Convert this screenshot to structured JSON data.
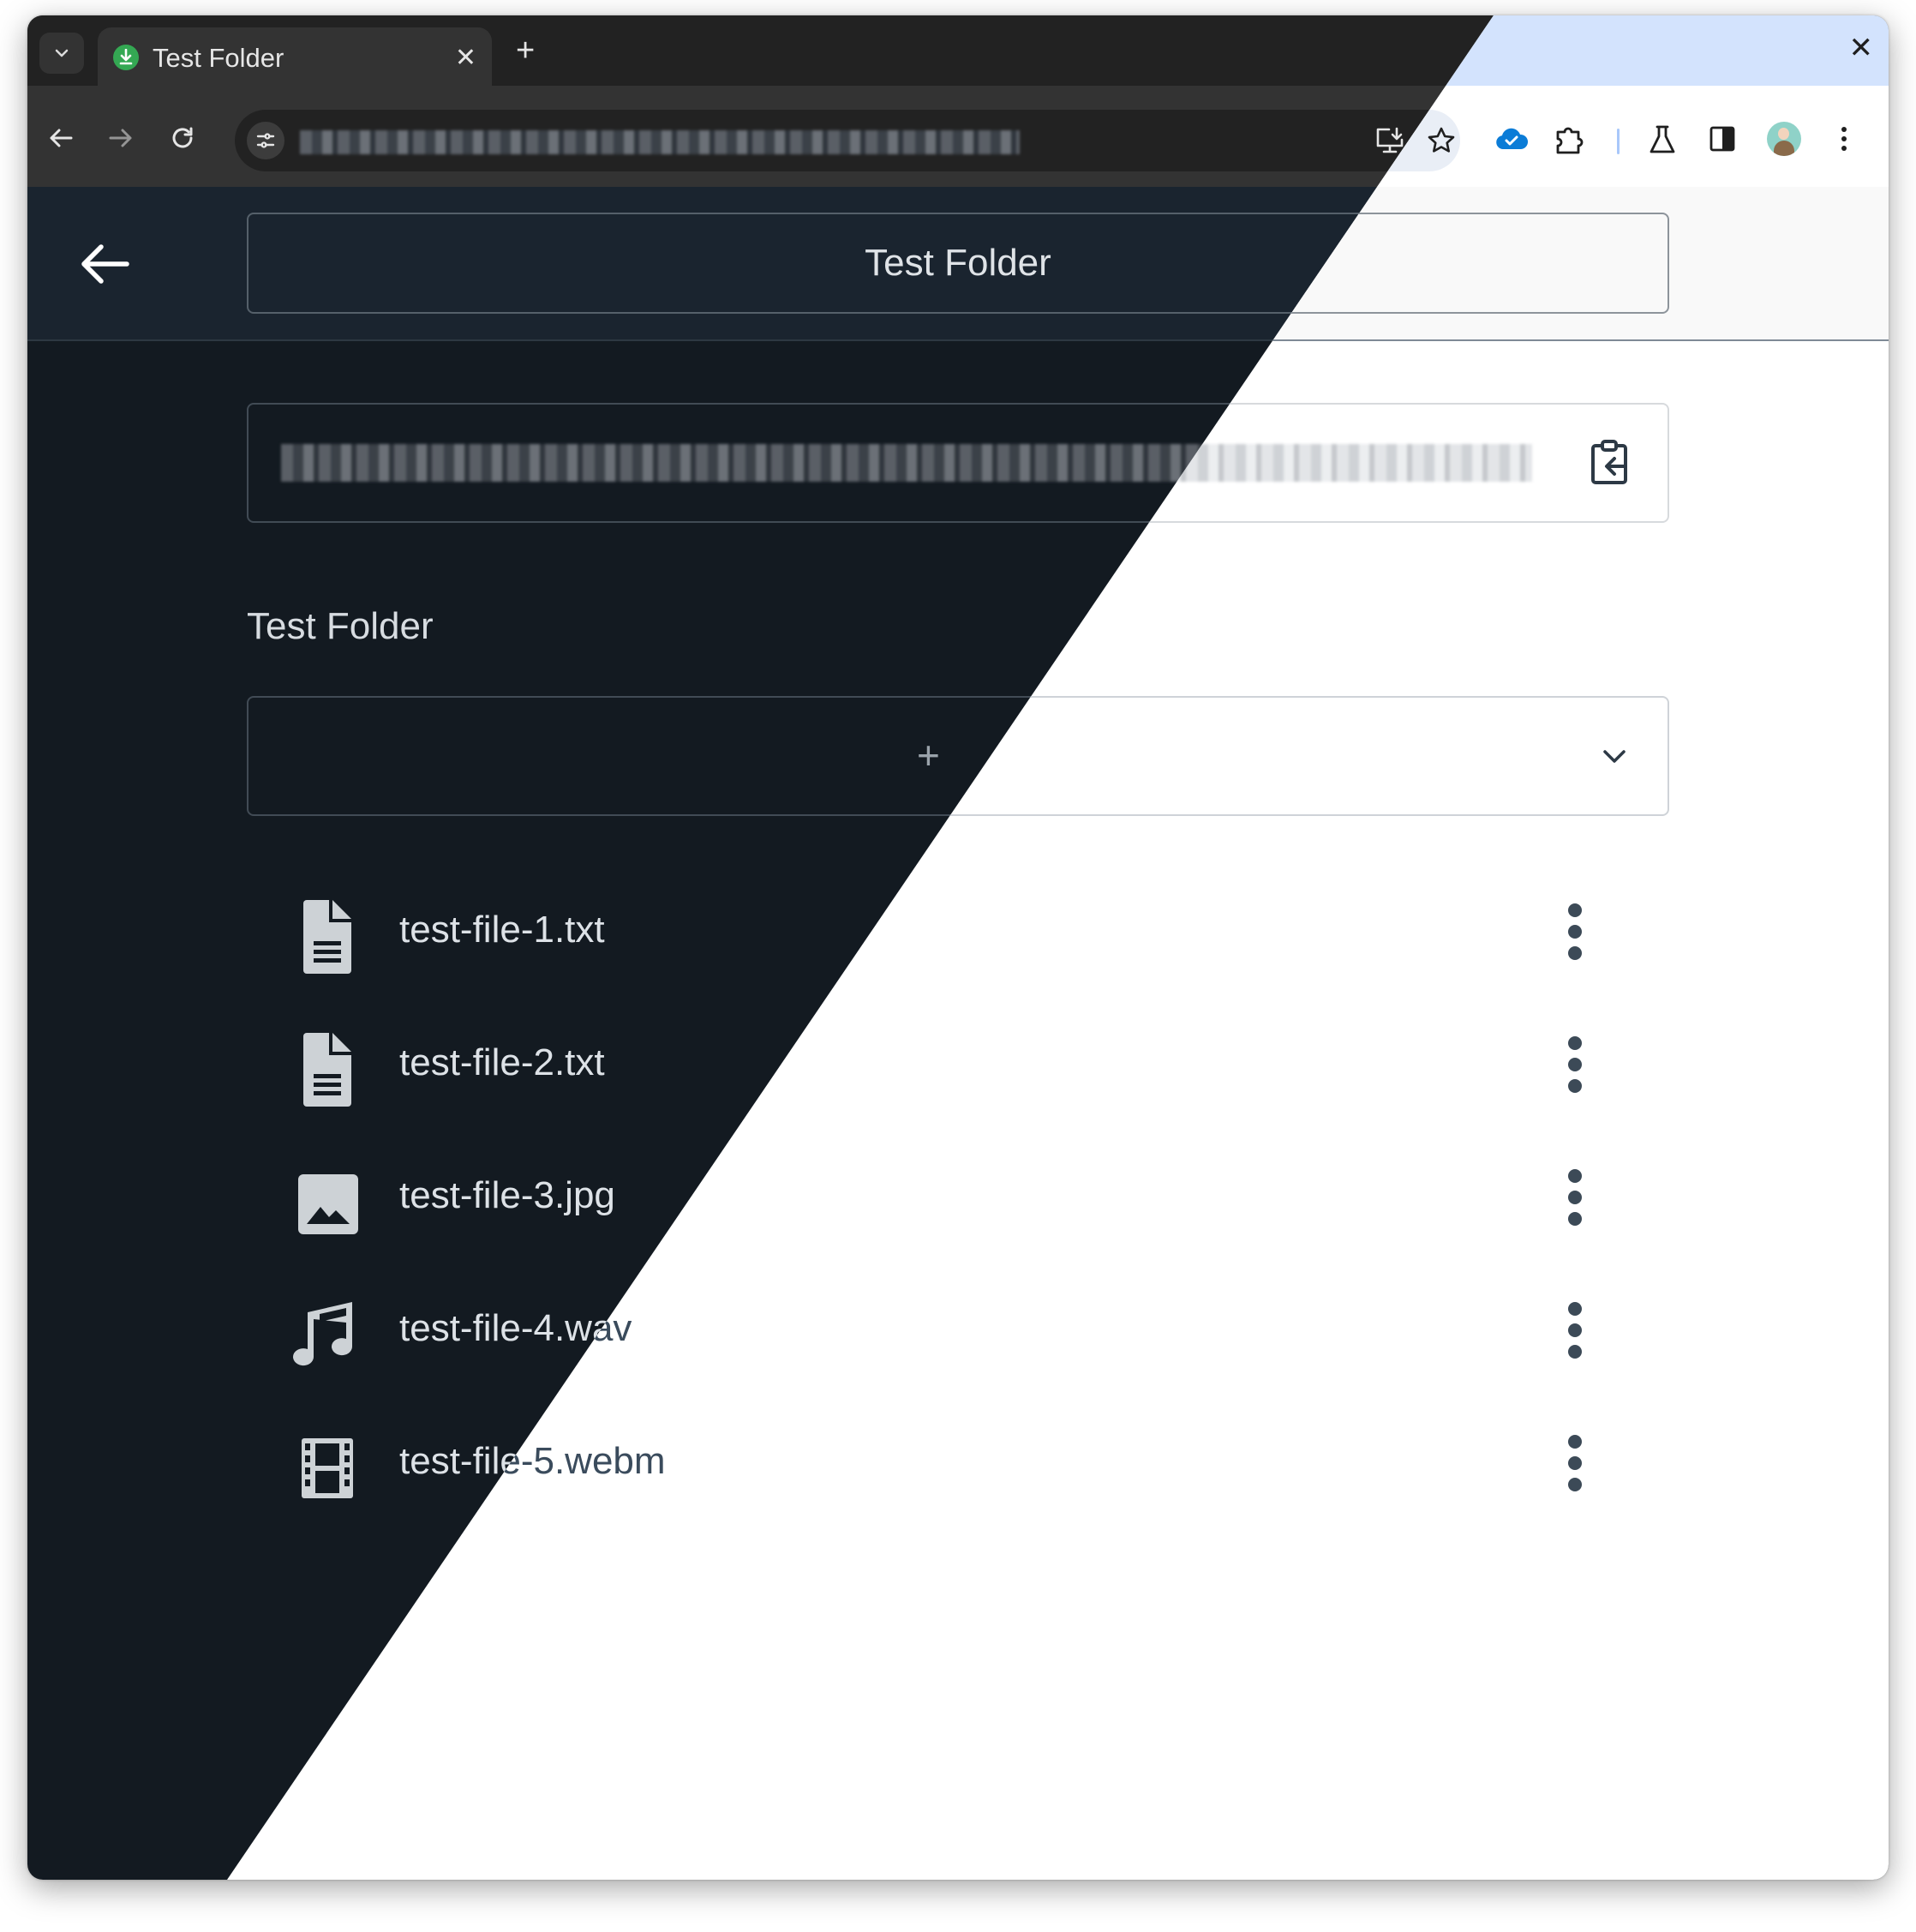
{
  "browser": {
    "tab_title": "Test Folder",
    "tab_close": "✕",
    "new_tab": "+",
    "window_close": "✕",
    "icons": [
      "tab-search-icon",
      "download-favicon-icon",
      "back-icon",
      "forward-icon",
      "reload-icon",
      "site-info-icon",
      "install-app-icon",
      "bookmark-star-icon",
      "cloud-icon",
      "extensions-icon",
      "labs-icon",
      "side-panel-icon",
      "avatar",
      "more-menu-icon"
    ]
  },
  "header": {
    "title": "Test Folder"
  },
  "share": {
    "url": "",
    "copy_icon": "clipboard-copy-icon"
  },
  "folder": {
    "title": "Test Folder",
    "add_label": "+"
  },
  "files": [
    {
      "name": "test-file-1.txt",
      "icon": "text-file-icon"
    },
    {
      "name": "test-file-2.txt",
      "icon": "text-file-icon"
    },
    {
      "name": "test-file-3.jpg",
      "icon": "image-file-icon"
    },
    {
      "name": "test-file-4.wav",
      "icon": "audio-file-icon"
    },
    {
      "name": "test-file-5.webm",
      "icon": "video-file-icon"
    }
  ],
  "colors": {
    "dark_bg": "#131a21",
    "light_bg": "#ffffff",
    "favicon_green": "#34a853",
    "cloud_blue": "#0b7cd7"
  }
}
